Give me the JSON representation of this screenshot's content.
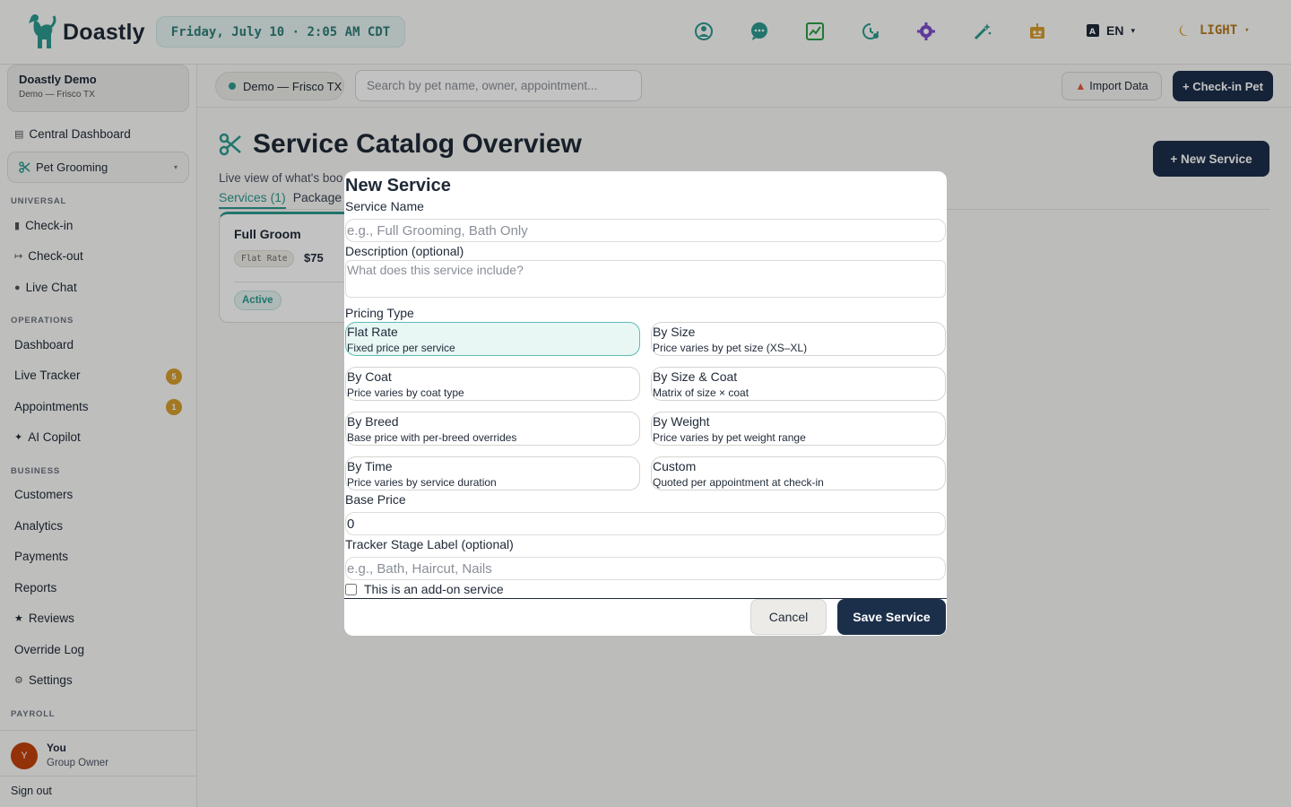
{
  "app": {
    "name": "Doastly"
  },
  "topbar": {
    "datetime": "Friday, July 10 · 2:05 AM CDT",
    "icons": [
      "support-icon",
      "chat-icon",
      "analytics-icon",
      "clock-icon",
      "settings-icon",
      "magic-wand-icon",
      "robot-icon"
    ],
    "language": {
      "code": "EN",
      "caret": "▾"
    },
    "theme": {
      "label": "LIGHT",
      "caret": "▾"
    }
  },
  "sidebar": {
    "org": {
      "name": "Doastly Demo",
      "sub": "Demo — Frisco TX"
    },
    "central_dashboard": "Central Dashboard",
    "module": {
      "label": "Pet Grooming",
      "caret": "▾"
    },
    "sections": {
      "universal": "UNIVERSAL",
      "operations": "OPERATIONS",
      "business": "BUSINESS",
      "payroll": "PAYROLL"
    },
    "items": {
      "checkin": "Check-in",
      "checkout": "Check-out",
      "livechat": "Live Chat",
      "dashboard": "Dashboard",
      "livetracker": "Live Tracker",
      "livetracker_badge": "5",
      "appointments": "Appointments",
      "appointments_badge": "1",
      "aicopilot": "AI Copilot",
      "customers": "Customers",
      "analytics": "Analytics",
      "payments": "Payments",
      "reports": "Reports",
      "reviews": "Reviews",
      "overridelog": "Override Log",
      "settings": "Settings"
    },
    "user": {
      "initial": "Y",
      "name": "You",
      "role": "Group Owner"
    },
    "signout": "Sign out"
  },
  "subbar": {
    "location": "Demo — Frisco TX",
    "search_placeholder": "Search by pet name, owner, appointment...",
    "import_label": "Import Data",
    "checkin_label": "+ Check-in Pet"
  },
  "page": {
    "title": "Service Catalog Overview",
    "subtitle": "Live view of what's boo",
    "new_service_label": "+ New Service",
    "tabs": {
      "services": "Services (1)",
      "packages": "Package"
    },
    "card": {
      "title": "Full Groom",
      "tag": "Flat Rate",
      "price": "$75",
      "status": "Active"
    }
  },
  "modal": {
    "title": "New Service",
    "service_name_label": "Service Name",
    "service_name_placeholder": "e.g., Full Grooming, Bath Only",
    "description_label": "Description (optional)",
    "description_placeholder": "What does this service include?",
    "pricing_type_label": "Pricing Type",
    "pricing_options": [
      {
        "title": "Flat Rate",
        "desc": "Fixed price per service",
        "selected": true
      },
      {
        "title": "By Size",
        "desc": "Price varies by pet size (XS–XL)",
        "selected": false
      },
      {
        "title": "By Coat",
        "desc": "Price varies by coat type",
        "selected": false
      },
      {
        "title": "By Size & Coat",
        "desc": "Matrix of size × coat",
        "selected": false
      },
      {
        "title": "By Breed",
        "desc": "Base price with per-breed overrides",
        "selected": false
      },
      {
        "title": "By Weight",
        "desc": "Price varies by pet weight range",
        "selected": false
      },
      {
        "title": "By Time",
        "desc": "Price varies by service duration",
        "selected": false
      },
      {
        "title": "Custom",
        "desc": "Quoted per appointment at check-in",
        "selected": false
      }
    ],
    "base_price_label": "Base Price",
    "base_price_value": "0",
    "tracker_label": "Tracker Stage Label (optional)",
    "tracker_placeholder": "e.g., Bath, Haircut, Nails",
    "addon_label": "This is an add-on service",
    "addon_checked": false,
    "cancel_label": "Cancel",
    "save_label": "Save Service"
  },
  "colors": {
    "accent": "#2c9a8f",
    "primary": "#1c2f4a",
    "badge": "#d69e2e"
  }
}
